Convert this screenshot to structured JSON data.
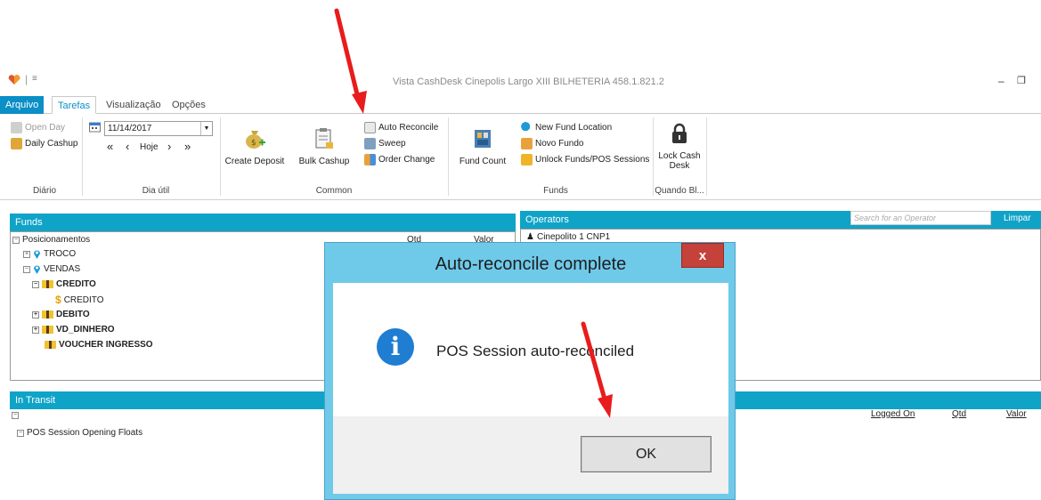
{
  "window": {
    "title": "Vista CashDesk  Cinepolis Largo XIII  BILHETERIA  458.1.821.2",
    "quick_access": "‑",
    "min": "–",
    "max": "❐"
  },
  "tabs": [
    "Arquivo",
    "Tarefas",
    "Visualização",
    "Opções"
  ],
  "ribbon": {
    "diario": {
      "open_day": "Open Day",
      "daily_cashup": "Daily Cashup",
      "label": "Diário"
    },
    "dia_util": {
      "date": "11/14/2017",
      "prev_fast": "«",
      "prev": "‹",
      "today": "Hoje",
      "next": "›",
      "next_fast": "»",
      "label": "Dia útil"
    },
    "common": {
      "create_deposit": "Create Deposit",
      "bulk_cashup": "Bulk Cashup",
      "auto_reconcile": "Auto Reconcile",
      "sweep": "Sweep",
      "order_change": "Order Change",
      "label": "Common"
    },
    "funds": {
      "fund_count": "Fund Count",
      "new_fund_location": "New Fund Location",
      "novo_fundo": "Novo Fundo",
      "unlock": "Unlock Funds/POS Sessions",
      "label": "Funds"
    },
    "quando": {
      "lock_cash_desk_1": "Lock Cash",
      "lock_cash_desk_2": "Desk",
      "label": "Quando Bl..."
    }
  },
  "funds_panel": {
    "title": "Funds",
    "col_qtd": "Qtd",
    "col_valor": "Valor",
    "tree": {
      "root": "Posicionamentos",
      "troco": "TROCO",
      "vendas": "VENDAS",
      "credito": "CREDITO",
      "credito_child": "CREDITO",
      "debito": "DEBITO",
      "vd_dinheiro": "VD_DINHERO",
      "voucher": "VOUCHER INGRESSO"
    }
  },
  "operators_panel": {
    "title": "Operators",
    "search_placeholder": "Search for an Operator",
    "clear": "Limpar",
    "first_operator": "Cinepolito 1 CNP1",
    "col_logged_on": "Logged On",
    "col_qtd": "Qtd",
    "col_valor": "Valor"
  },
  "transit_panel": {
    "title": "In Transit",
    "row1": "POS Session Opening Floats"
  },
  "dialog": {
    "title": "Auto-reconcile complete",
    "close": "x",
    "message": "POS Session auto-reconciled",
    "ok": "OK",
    "info_glyph": "i"
  },
  "colors": {
    "accent": "#10a3c8",
    "file_tab": "#0a8fc7",
    "dialog_frame": "#6fcaea",
    "close_red": "#c4423a",
    "annotation_arrow": "#e81c1c"
  }
}
